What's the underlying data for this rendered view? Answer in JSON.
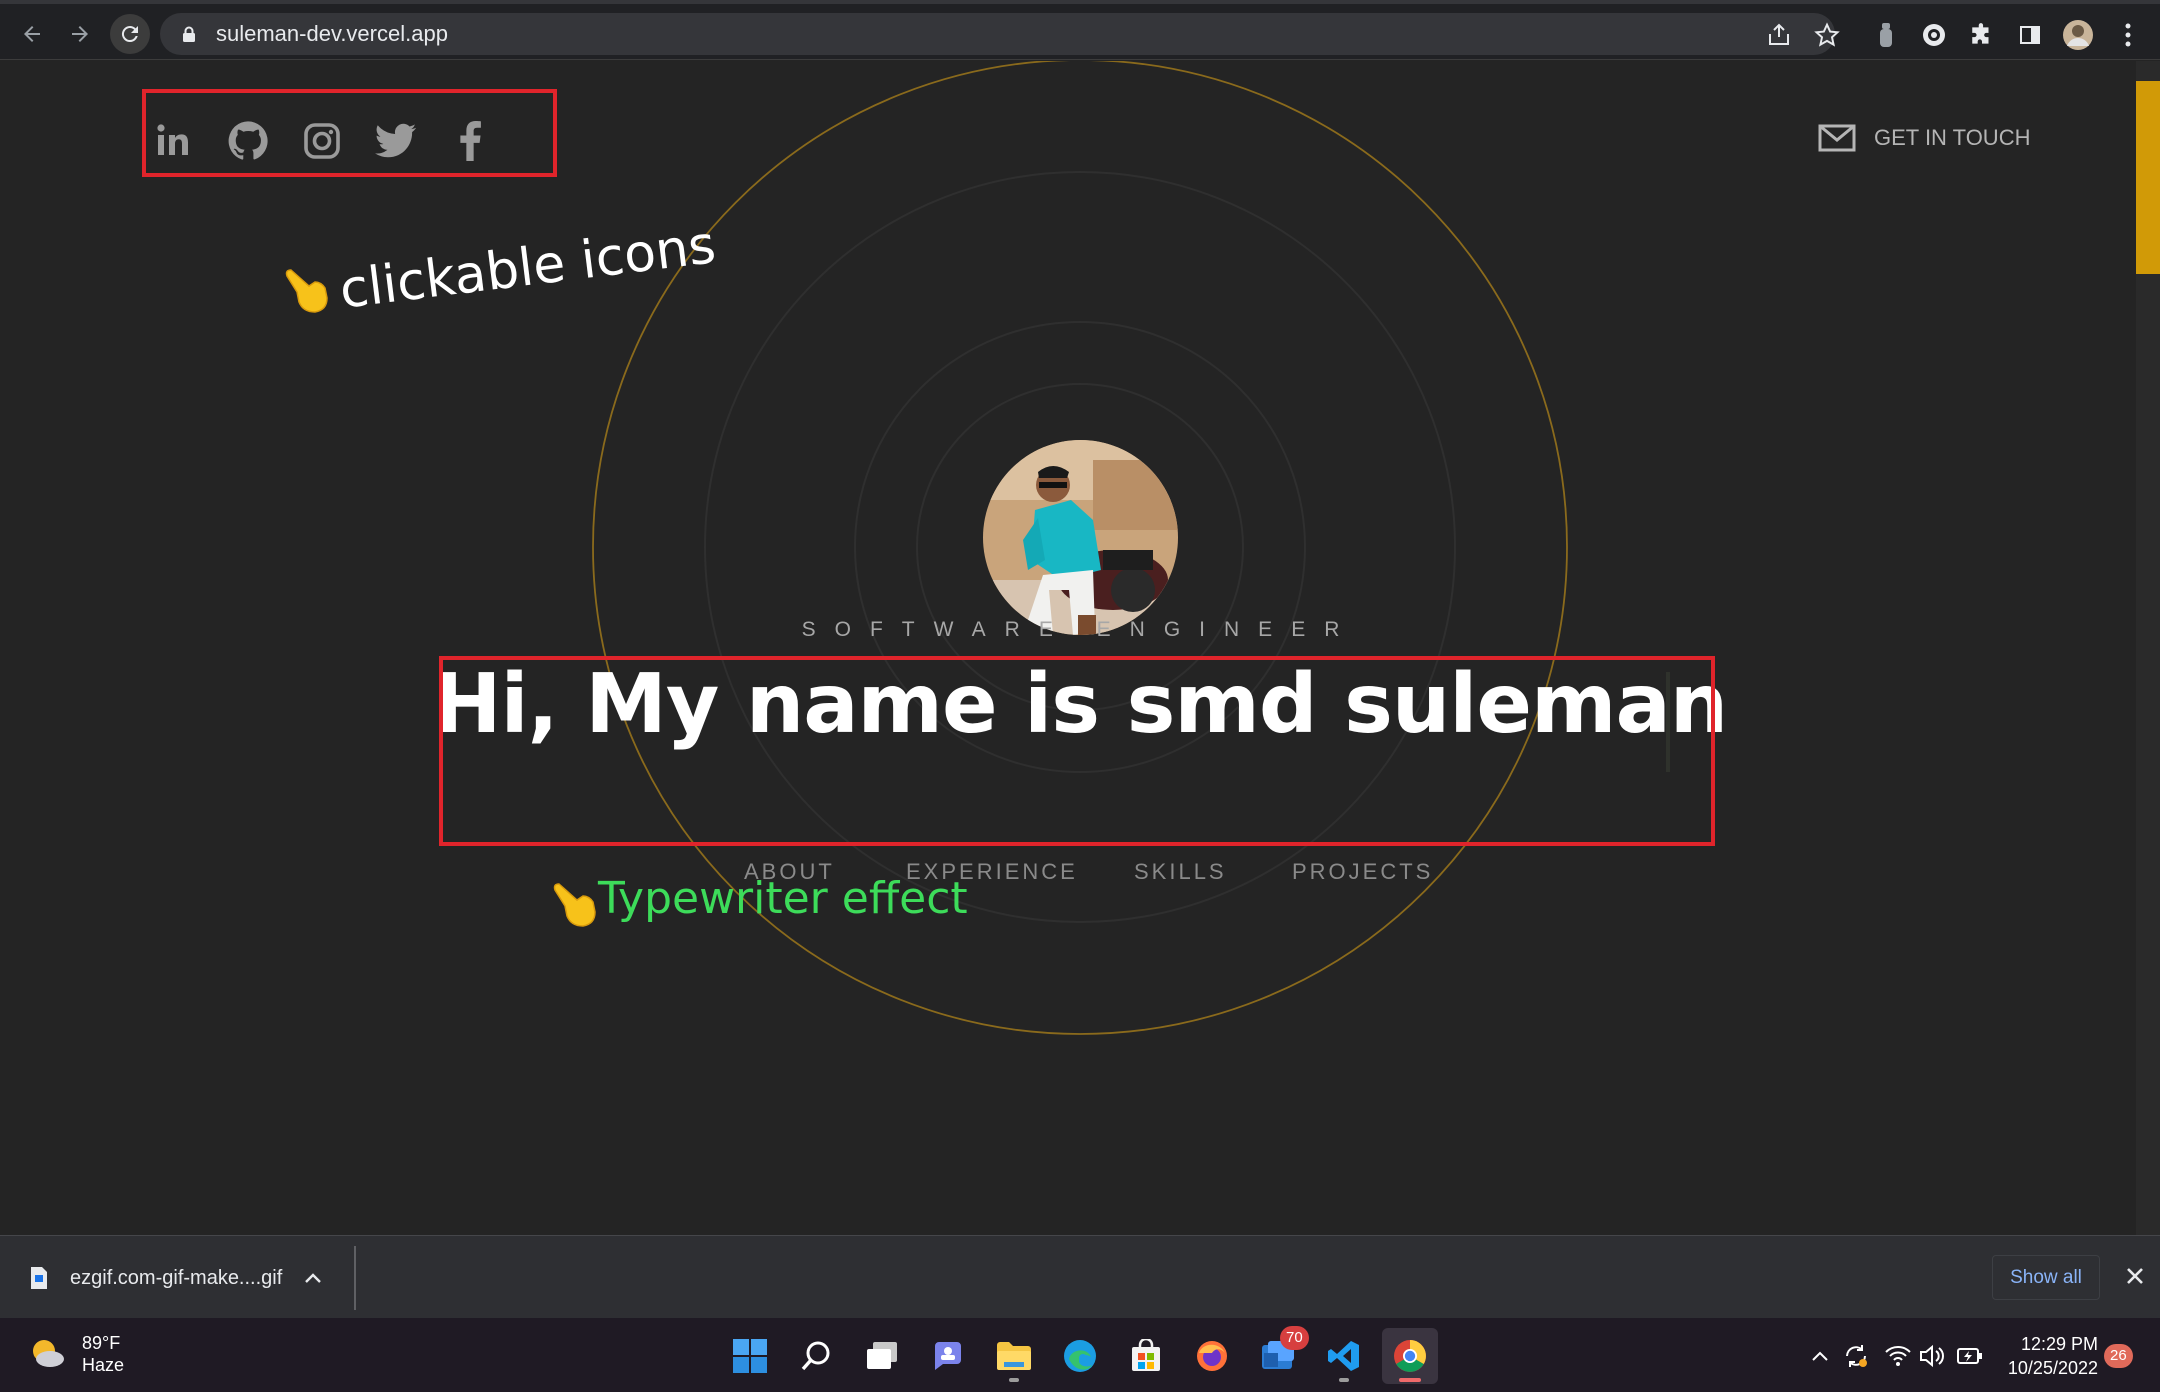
{
  "browser": {
    "url": "suleman-dev.vercel.app",
    "back_icon": "arrow-left-icon",
    "forward_icon": "arrow-right-icon",
    "reload_icon": "reload-icon"
  },
  "site": {
    "social": [
      {
        "name": "linkedin",
        "glyph": "in"
      },
      {
        "name": "github"
      },
      {
        "name": "instagram"
      },
      {
        "name": "twitter"
      },
      {
        "name": "facebook",
        "glyph": "f"
      }
    ],
    "contact_label": "GET IN TOUCH",
    "tagline": "SOFTWARE ENGINEER",
    "headline": "Hi, My name is smd suleman",
    "nav": [
      "ABOUT",
      "EXPERIENCE",
      "SKILLS",
      "PROJECTS"
    ],
    "accent_color": "#d19a07"
  },
  "annotations": {
    "icons_note": "clickable icons",
    "typewriter_note": "Typewriter effect",
    "box_color": "#e0242b",
    "green_color": "#3ddc5a"
  },
  "downloads": {
    "file_name": "ezgif.com-gif-make....gif",
    "show_all": "Show all"
  },
  "taskbar": {
    "weather_temp": "89°F",
    "weather_desc": "Haze",
    "teams_badge": "70",
    "time": "12:29 PM",
    "date": "10/25/2022",
    "notifications": "26"
  }
}
